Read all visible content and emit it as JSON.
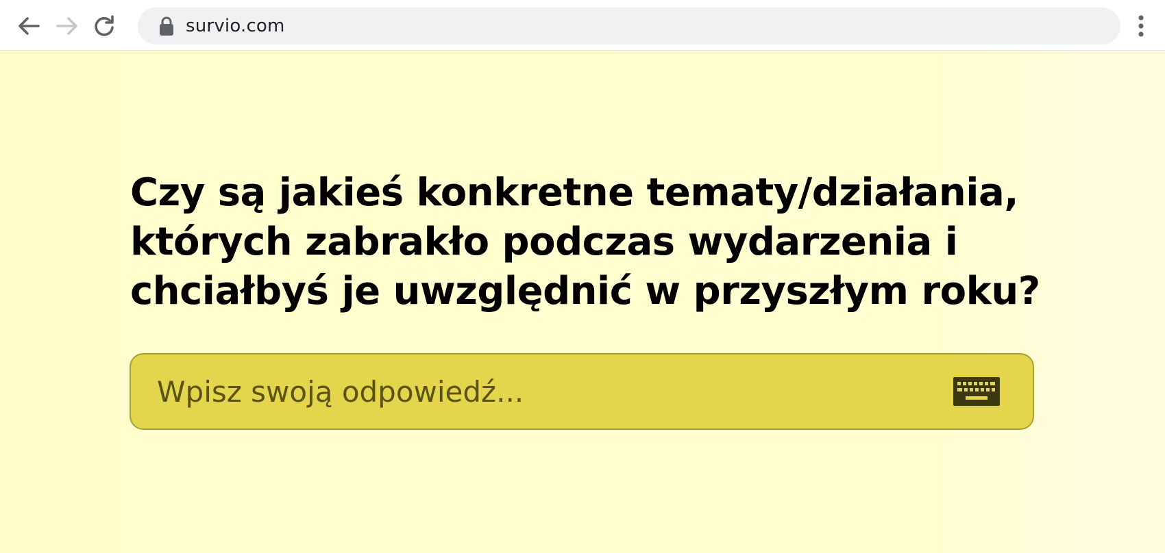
{
  "browser": {
    "url": "survio.com",
    "icons": {
      "back": "arrow-left-icon",
      "forward": "arrow-right-icon",
      "reload": "reload-icon",
      "lock": "lock-icon",
      "menu": "kebab-menu-icon"
    }
  },
  "question": {
    "text": "Czy są jakieś konkretne tematy/działania, których zabrakło podczas wydarzenia i chciałbyś je uwzględnić w przyszłym roku?"
  },
  "answer": {
    "value": "",
    "placeholder": "Wpisz swoją odpowiedź...",
    "icon": "keyboard-icon"
  },
  "colors": {
    "page_background": "#ffffce",
    "input_background": "#e3d54c",
    "input_border": "#a8a032",
    "question_text": "#000000",
    "icon_dark": "#3d3810"
  }
}
